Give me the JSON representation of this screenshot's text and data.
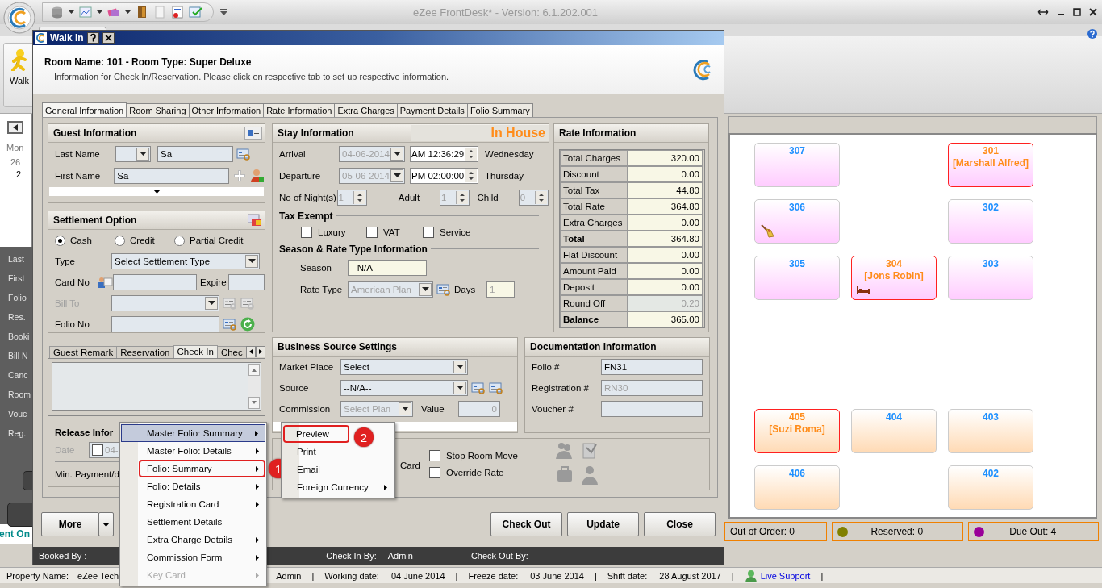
{
  "app": {
    "title": "eZee FrontDesk* - Version: 6.1.202.001",
    "ribbon_button": "Walk"
  },
  "calendar": {
    "day": "Mon",
    "dates": [
      "26",
      "2"
    ]
  },
  "search_labels": [
    "Last",
    "First",
    "Folio",
    "Res.",
    "Booki",
    "Bill N",
    "Canc",
    "Room",
    "Vouc",
    "Reg."
  ],
  "left_footer": "ent On",
  "room_panel": {
    "floors": [
      {
        "color": "#ffccff",
        "rows": [
          [
            {
              "number": "307",
              "occupied": false,
              "kind": "clean"
            },
            null,
            {
              "number": "301",
              "guest": "[Marshall Alfred]",
              "occupied": true,
              "kind": "clean"
            }
          ],
          [
            {
              "number": "306",
              "occupied": false,
              "kind": "dirty"
            },
            null,
            {
              "number": "302",
              "occupied": false,
              "kind": "clean"
            }
          ],
          [
            {
              "number": "305",
              "occupied": false,
              "kind": "clean"
            },
            {
              "number": "304",
              "guest": "[Jons Robin]",
              "occupied": true,
              "kind": "stayover"
            },
            {
              "number": "303",
              "occupied": false,
              "kind": "clean"
            }
          ]
        ]
      },
      {
        "color": "#ffdab4",
        "rows": [
          [
            {
              "number": "405",
              "guest": "[Suzi Roma]",
              "occupied": true,
              "kind": "clean"
            },
            {
              "number": "404",
              "occupied": false,
              "kind": "clean"
            },
            {
              "number": "403",
              "occupied": false,
              "kind": "clean"
            }
          ],
          [
            {
              "number": "406",
              "occupied": false,
              "kind": "clean"
            },
            null,
            {
              "number": "402",
              "occupied": false,
              "kind": "clean"
            }
          ]
        ]
      }
    ]
  },
  "legend": [
    {
      "label": "Out of Order: 0"
    },
    {
      "label": "Reserved: 0",
      "color": "#808000"
    },
    {
      "label": "Due Out: 4",
      "color": "#990099"
    }
  ],
  "status_bar": {
    "property_label": "Property Name:",
    "property": "eZee Tech",
    "user": "Admin",
    "working_label": "Working date:",
    "working": "04 June 2014",
    "freeze_label": "Freeze date:",
    "freeze": "03 June 2014",
    "shift_label": "Shift date:",
    "shift": "28 August 2017",
    "support": "Live Support",
    "separator": "|"
  },
  "dialog": {
    "title": "Walk In",
    "heading": "Room Name: 101 - Room Type: Super Deluxe",
    "subtitle": "Information for Check In/Reservation. Please click on respective tab to set up respective information.",
    "tabs": [
      {
        "label": "General Information",
        "selected": true
      },
      {
        "label": "Room Sharing",
        "selected": false
      },
      {
        "label": "Other Information",
        "selected": false
      },
      {
        "label": "Rate Information",
        "selected": false
      },
      {
        "label": "Extra Charges",
        "selected": false
      },
      {
        "label": "Payment Details",
        "selected": false
      },
      {
        "label": "Folio Summary",
        "selected": false
      }
    ],
    "guest": {
      "title": "Guest Information",
      "last_name_label": "Last Name",
      "last_name": "Sa",
      "first_name_label": "First Name",
      "first_name": "Sa"
    },
    "settlement": {
      "title": "Settlement Option",
      "options": [
        {
          "label": "Cash",
          "selected": true
        },
        {
          "label": "Credit",
          "selected": false
        },
        {
          "label": "Partial Credit",
          "selected": false
        }
      ],
      "type_label": "Type",
      "type": "Select Settlement Type",
      "card_label": "Card No",
      "expire_label": "Expire",
      "bill_to_label": "Bill To",
      "bill_to_disabled": true,
      "folio_label": "Folio No"
    },
    "remark_tabs": [
      {
        "label": "Guest Remark",
        "selected": false
      },
      {
        "label": "Reservation",
        "selected": false
      },
      {
        "label": "Check In",
        "selected": true
      },
      {
        "label": "Chec",
        "selected": false
      }
    ],
    "release": {
      "title": "Release Infor",
      "date_label": "Date",
      "date_checked": false,
      "date": "04-",
      "min_payment": "Min. Payment/d"
    },
    "stay": {
      "title": "Stay Information",
      "status": "In House",
      "dates_disabled": true,
      "counts_disabled": true,
      "arrival": {
        "label": "Arrival",
        "date": "04-06-2014",
        "time": "AM 12:36:29",
        "day": "Wednesday"
      },
      "departure": {
        "label": "Departure",
        "date": "05-06-2014",
        "time": "PM 02:00:00",
        "day": "Thursday"
      },
      "nights_label": "No of Night(s)",
      "nights": "1",
      "adult_label": "Adult",
      "adults": "1",
      "child_label": "Child",
      "children": "0",
      "tax_title": "Tax Exempt",
      "tax": [
        {
          "label": "Luxury",
          "checked": false
        },
        {
          "label": "VAT",
          "checked": false
        },
        {
          "label": "Service",
          "checked": false
        }
      ],
      "season_title": "Season & Rate Type Information",
      "season_label": "Season",
      "season": "--N/A--",
      "rate_type_label": "Rate Type",
      "rate_type": "American Plan",
      "rate_type_disabled": true,
      "days_label": "Days",
      "days": "1"
    },
    "rate": {
      "title": "Rate Information",
      "rows": [
        {
          "label": "Total Charges",
          "value": "320.00",
          "bold": false,
          "disabled": false
        },
        {
          "label": "Discount",
          "value": "0.00",
          "bold": false,
          "disabled": false
        },
        {
          "label": "Total Tax",
          "value": "44.80",
          "bold": false,
          "disabled": false
        },
        {
          "label": "Total Rate",
          "value": "364.80",
          "bold": false,
          "disabled": false
        },
        {
          "label": "Extra Charges",
          "value": "0.00",
          "bold": false,
          "disabled": false
        },
        {
          "label": "Total",
          "value": "364.80",
          "bold": true,
          "disabled": false
        },
        {
          "label": "Flat Discount",
          "value": "0.00",
          "bold": false,
          "disabled": false
        },
        {
          "label": "Amount Paid",
          "value": "0.00",
          "bold": false,
          "disabled": false
        },
        {
          "label": "Deposit",
          "value": "0.00",
          "bold": false,
          "disabled": false
        },
        {
          "label": "Round Off",
          "value": "0.20",
          "bold": false,
          "disabled": true
        },
        {
          "label": "Balance",
          "value": "365.00",
          "bold": true,
          "disabled": false
        }
      ]
    },
    "business": {
      "title": "Business Source Settings",
      "market_label": "Market Place",
      "market": "Select",
      "source_label": "Source",
      "source": "--N/A--",
      "commission_label": "Commission",
      "commission": "Select Plan",
      "commission_disabled": true,
      "value_label": "Value",
      "value": "0"
    },
    "documentation": {
      "title": "Documentation Information",
      "folio_label": "Folio #",
      "folio": "FN31",
      "registration_label": "Registration #",
      "registration": "RN30",
      "registration_disabled": true,
      "voucher_label": "Voucher #"
    },
    "options": {
      "card_label": "Card",
      "checks": [
        {
          "label": "Stop Room Move",
          "checked": false
        },
        {
          "label": "Override Rate",
          "checked": false
        }
      ]
    },
    "more": "More",
    "actions": [
      "Check Out",
      "Update",
      "Close"
    ],
    "footer": {
      "booked_by_label": "Booked By :",
      "check_in_by_label": "Check In By:",
      "check_in_by": "Admin",
      "check_out_by_label": "Check Out By:"
    },
    "menu": [
      {
        "label": "Master Folio: Summary",
        "selected": true,
        "submenu": true,
        "disabled": false
      },
      {
        "label": "Master Folio: Details",
        "selected": false,
        "submenu": true,
        "disabled": false
      },
      {
        "label": "Folio: Summary",
        "selected": false,
        "submenu": true,
        "disabled": false,
        "callout": "1"
      },
      {
        "label": "Folio: Details",
        "selected": false,
        "submenu": true,
        "disabled": false
      },
      {
        "label": "Registration Card",
        "selected": false,
        "submenu": true,
        "disabled": false
      },
      {
        "label": "Settlement Details",
        "selected": false,
        "submenu": false,
        "disabled": false
      },
      {
        "label": "Extra Charge Details",
        "selected": false,
        "submenu": true,
        "disabled": false
      },
      {
        "label": "Commission Form",
        "selected": false,
        "submenu": true,
        "disabled": false
      },
      {
        "label": "Key Card",
        "selected": false,
        "submenu": true,
        "disabled": true
      }
    ],
    "submenu": [
      {
        "label": "Preview",
        "submenu": false,
        "callout": "2"
      },
      {
        "label": "Print",
        "submenu": false
      },
      {
        "label": "Email",
        "submenu": false
      },
      {
        "label": "Foreign Currency",
        "submenu": true
      }
    ]
  }
}
